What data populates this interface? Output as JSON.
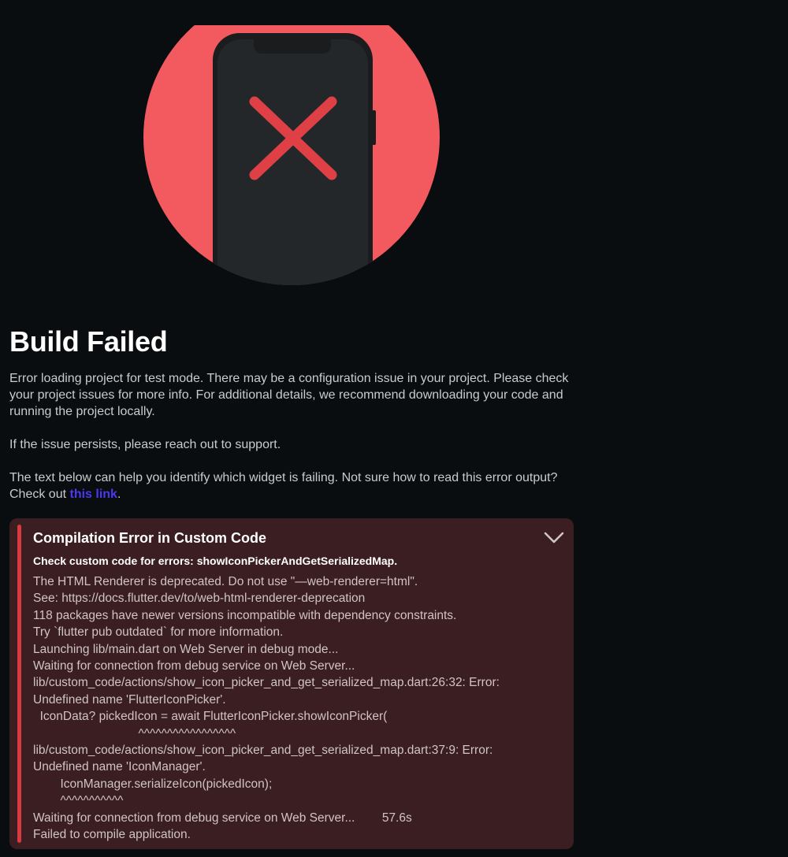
{
  "illustration": {
    "icon": "phone-error-icon",
    "colors": {
      "circle": "#f35a5f",
      "phone": "#212325",
      "x_mark": "#df4045"
    }
  },
  "header": {
    "title": "Build Failed"
  },
  "intro": {
    "paragraph1": "Error loading project for test mode. There may be a configuration issue in your project. Please check your project issues for more info. For additional details, we recommend downloading your code and running the project locally.",
    "paragraph2": "If the issue persists, please reach out to support.",
    "paragraph3_prefix": "The text below can help you identify which widget is failing. Not sure how to read this error output? Check out ",
    "paragraph3_link": "this link",
    "paragraph3_suffix": "."
  },
  "error_panel": {
    "title": "Compilation Error in Custom Code",
    "subtitle": "Check custom code for errors: showIconPickerAndGetSerializedMap.",
    "expand_icon": "chevron-down-icon",
    "log_lines": [
      "The HTML Renderer is deprecated. Do not use \"—web-renderer=html\".",
      "See: https://docs.flutter.dev/to/web-html-renderer-deprecation",
      "118 packages have newer versions incompatible with dependency constraints.",
      "Try `flutter pub outdated` for more information.",
      "Launching lib/main.dart on Web Server in debug mode...",
      "Waiting for connection from debug service on Web Server...",
      "lib/custom_code/actions/show_icon_picker_and_get_serialized_map.dart:26:32: Error:",
      "Undefined name 'FlutterIconPicker'.",
      "  IconData? pickedIcon = await FlutterIconPicker.showIconPicker(",
      "                               ^^^^^^^^^^^^^^^^^",
      "lib/custom_code/actions/show_icon_picker_and_get_serialized_map.dart:37:9: Error:",
      "Undefined name 'IconManager'.",
      "        IconManager.serializeIcon(pickedIcon);",
      "        ^^^^^^^^^^^",
      "Waiting for connection from debug service on Web Server...        57.6s",
      "Failed to compile application."
    ],
    "accent_color": "#d93a3f",
    "background_color": "#3a1e21"
  }
}
